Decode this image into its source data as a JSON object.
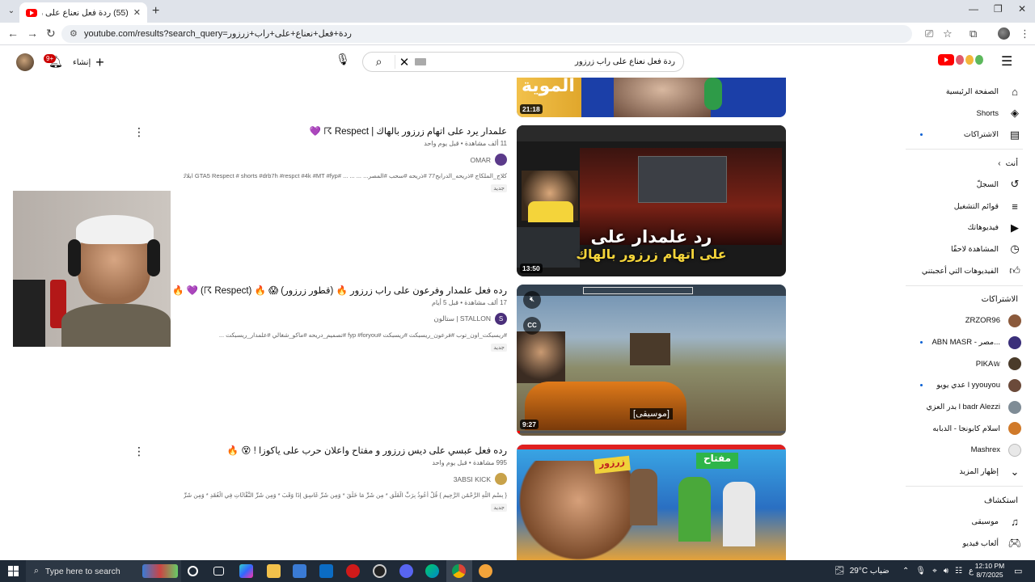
{
  "browser": {
    "tab_title": "(55) ردة فعل نعناع على راب زرزور",
    "url": "youtube.com/results?search_query=ردة+فعل+نعناع+على+راب+زرزور"
  },
  "header": {
    "notification_count": "9+",
    "create_label": "إنشاء",
    "search_query": "ردة فعل  نعناع على راب زرزور"
  },
  "sidebar": {
    "primary": [
      {
        "label": "الصفحة الرئيسية",
        "icon": "home-icon"
      },
      {
        "label": "Shorts",
        "icon": "shorts-icon"
      },
      {
        "label": "الاشتراكات",
        "icon": "subscriptions-icon"
      }
    ],
    "you_heading": "أنت",
    "you_items": [
      {
        "label": "السجلّ",
        "icon": "history-icon"
      },
      {
        "label": "قوائم التشغيل",
        "icon": "playlist-icon"
      },
      {
        "label": "فيديوهاتك",
        "icon": "your-videos-icon"
      },
      {
        "label": "المشاهدة لاحقًا",
        "icon": "watch-later-icon"
      },
      {
        "label": "الفيديوهات التي أعجبتني",
        "icon": "like-icon"
      }
    ],
    "subs_heading": "الاشتراكات",
    "subscriptions": [
      {
        "label": "ZRZOR96",
        "color": "#8b5a3c",
        "dot": false
      },
      {
        "label": "ABN MASR - مصر...",
        "color": "#3a2f7a",
        "dot": true
      },
      {
        "label": "PIKA𝕨",
        "color": "#4a3b2a",
        "dot": false
      },
      {
        "label": "عدي يويو l yyouyou",
        "color": "#6b4a3a",
        "dot": true
      },
      {
        "label": "بدر العزي l badr Alezzi",
        "color": "#7f8c96",
        "dot": false
      },
      {
        "label": "اسلام كابونجا - الدبابه",
        "color": "#d07a2a",
        "dot": false
      },
      {
        "label": "Mashrex",
        "color": "#e8e8e8",
        "dot": false
      },
      {
        "label": "إظهار المزيد",
        "color": "",
        "dot": false
      }
    ],
    "explore_heading": "استكشاف",
    "explore": [
      {
        "label": "موسيقى",
        "icon": "music-icon"
      },
      {
        "label": "ألعاب فيديو",
        "icon": "gaming-icon"
      }
    ]
  },
  "results": [
    {
      "title": "علمدار يرد على اتهام زرزور بالهاك | Respect ☈ 💜",
      "stats": "11 ألف مشاهدة • قبل يوم واحد",
      "channel": "OMAR",
      "channel_color": "#5b3a8a",
      "description": "كلاج_الملكاج #ذريحه_الدرابح77 #ذريحه #سحب #المصر... ... ... ... #GTA5 Respect # shorts #drb7h #respct #4k #MT #fyp ابلاك",
      "badge": "جديد",
      "duration": "13:50",
      "thumb_caption_1": "رد علمدار على",
      "thumb_caption_2": "على اتهام زرزور بالهاك"
    },
    {
      "title": "رده فعل علمدار وفرعون على راب زرزور 🔥 (قطور زرزور) 😱 🔥 (Respect ☈) 💜 🔥",
      "stats": "17 ألف مشاهدة • قبل 5 أيام",
      "channel": "STALLON | ستالون",
      "channel_color": "#4a2f7a",
      "description": "#ريسبكت_اون_توب #فرعون_ريسبكت #ريسبكت #fyp #foryou #تصميم_دريحه #ماكو_شغالي #علمدار_ريسبكت ...",
      "badge": "جديد",
      "duration": "9:27",
      "thumb_caption_1": "[موسيقى]"
    },
    {
      "title": "رده فعل عبسي على ديس زرزور و مفتاح واعلان حرب على ياكوزا ! 😵 🔥",
      "stats": "995 مشاهدة • قبل يوم واحد",
      "channel": "3ABSI KICK",
      "channel_color": "#c8a24a",
      "description": "{ بِسْمِ اللَّهِ الرَّحْمَٰنِ الرَّحِيمِ } قُلْ أَعُوذُ بِرَبِّ الْفَلَقِ * مِن شَرِّ مَا خَلَقَ * وَمِن شَرِّ غَاسِقٍ إِذَا وَقَبَ * وَمِن شَرِّ النَّفَّاثَاتِ فِي الْعُقَدِ * وَمِن شَرِّ حَاسِدٍ إِذَا حَسَدَ ...",
      "badge": "جديد",
      "thumb_caption_1": "مفتاح",
      "thumb_caption_2": "زرزور"
    }
  ],
  "top_thumb_duration": "21:18",
  "top_thumb_text": "الموية",
  "taskbar": {
    "search_placeholder": "Type here to search",
    "weather": "29°C  ضباب",
    "lang": "ع",
    "time": "12:10 PM",
    "date": "8/7/2025"
  }
}
